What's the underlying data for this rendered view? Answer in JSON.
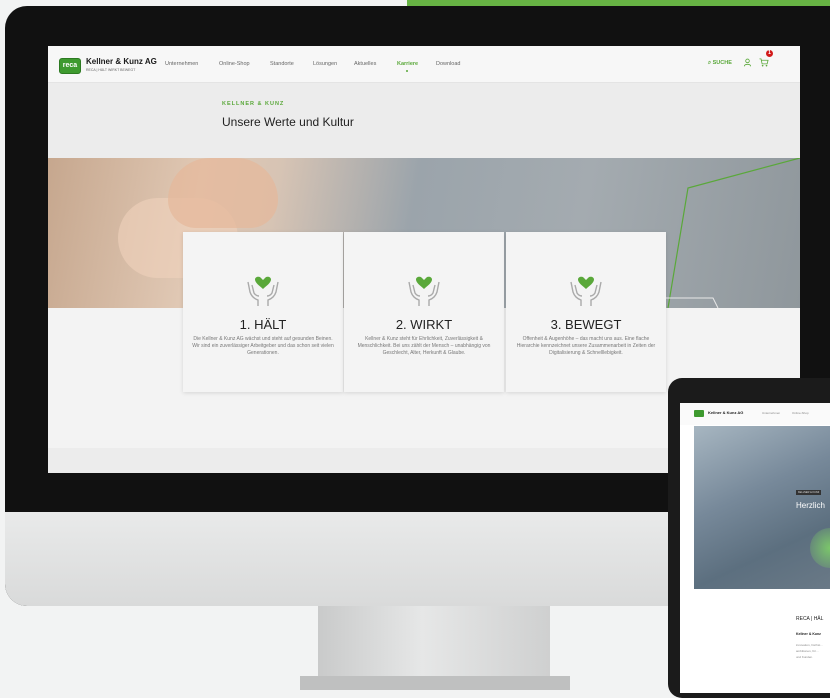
{
  "colors": {
    "accent": "#5aa83a",
    "brand_green": "#67b344",
    "cart_badge": "#d21a1a",
    "frame": "#111111"
  },
  "desktop": {
    "brand": {
      "logo_text": "reca",
      "name": "Kellner & Kunz AG",
      "tagline": "RECA | HÄLT WIRKT BEWEGT"
    },
    "nav": {
      "items": [
        {
          "label": "Unternehmen",
          "active": false
        },
        {
          "label": "Online-Shop",
          "active": false
        },
        {
          "label": "Standorte",
          "active": false
        },
        {
          "label": "Lösungen",
          "active": false
        },
        {
          "label": "Aktuelles",
          "active": false
        },
        {
          "label": "Karriere",
          "active": true
        },
        {
          "label": "Download",
          "active": false
        }
      ],
      "search_label": "SUCHE",
      "user_icon": "user-icon",
      "cart_icon": "cart-icon",
      "cart_count": "1"
    },
    "eyebrow": "KELLNER & KUNZ",
    "title": "Unsere Werte und Kultur",
    "values": [
      {
        "title": "1. HÄLT",
        "text": "Die Kellner & Kunz AG wächst und steht auf gesunden Beinen. Wir sind ein zuverlässiger Arbeitgeber und das schon seit vielen Generationen.",
        "icon": "heart-hands-icon"
      },
      {
        "title": "2. WIRKT",
        "text": "Kellner & Kunz steht für Ehrlichkeit, Zuverlässigkeit & Menschlichkeit. Bei uns zählt der Mensch – unabhängig von Geschlecht, Alter, Herkunft & Glaube.",
        "icon": "heart-hands-icon"
      },
      {
        "title": "3. BEWEGT",
        "text": "Offenheit & Augenhöhe – das macht uns aus. Eine flache Hierarchie kennzeichnet unsere Zusammenarbeit in Zeiten der Digitalisierung & Schnelllebigkeit.",
        "icon": "heart-hands-icon"
      }
    ]
  },
  "tablet": {
    "brand": "Kellner & Kunz AG",
    "nav_items": [
      "Unternehmen",
      "Online-Shop"
    ],
    "hero_label": "KELLNER & KUNZ",
    "hero_title": "Herzlich",
    "section_title": "RECA | HÄL",
    "section_subtitle": "Kellner & Kunz",
    "text_lines": [
      "innovation, höchst…",
      "ambitionen, für…",
      "und Kunden."
    ]
  }
}
